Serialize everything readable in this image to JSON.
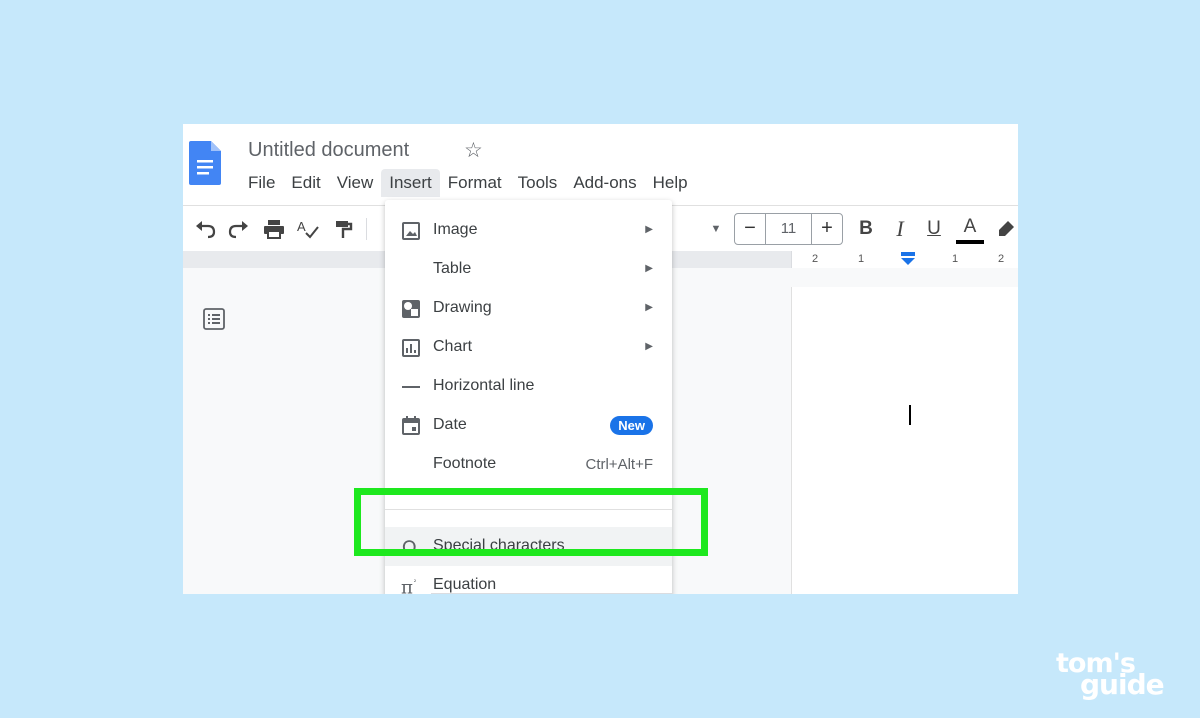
{
  "document": {
    "title": "Untitled document"
  },
  "menubar": [
    "File",
    "Edit",
    "View",
    "Insert",
    "Format",
    "Tools",
    "Add-ons",
    "Help"
  ],
  "toolbar": {
    "font_size": "11",
    "decrease_label": "−",
    "increase_label": "+",
    "bold_label": "B",
    "italic_label": "I",
    "underline_label": "U",
    "text_color_label": "A"
  },
  "ruler": [
    "2",
    "1",
    "1",
    "2"
  ],
  "insert_menu": {
    "items": [
      {
        "label": "Image",
        "icon": "image-icon",
        "submenu": true
      },
      {
        "label": "Table",
        "icon": "",
        "submenu": true
      },
      {
        "label": "Drawing",
        "icon": "drawing-icon",
        "submenu": true
      },
      {
        "label": "Chart",
        "icon": "chart-icon",
        "submenu": true
      },
      {
        "label": "Horizontal line",
        "icon": "horizontal-line-icon",
        "submenu": false
      },
      {
        "label": "Date",
        "icon": "calendar-icon",
        "badge": "New"
      },
      {
        "label": "Footnote",
        "icon": "",
        "shortcut": "Ctrl+Alt+F"
      },
      {
        "label": "Special characters",
        "icon": "omega-icon",
        "highlighted": true
      },
      {
        "label": "Equation",
        "icon": "pi-icon"
      }
    ]
  },
  "watermark": {
    "line1": "tom's",
    "line2": "guide"
  },
  "colors": {
    "background": "#c6e8fb",
    "highlight_box": "#1ee81e",
    "docs_blue": "#4285f4",
    "badge_blue": "#1a73e8"
  }
}
